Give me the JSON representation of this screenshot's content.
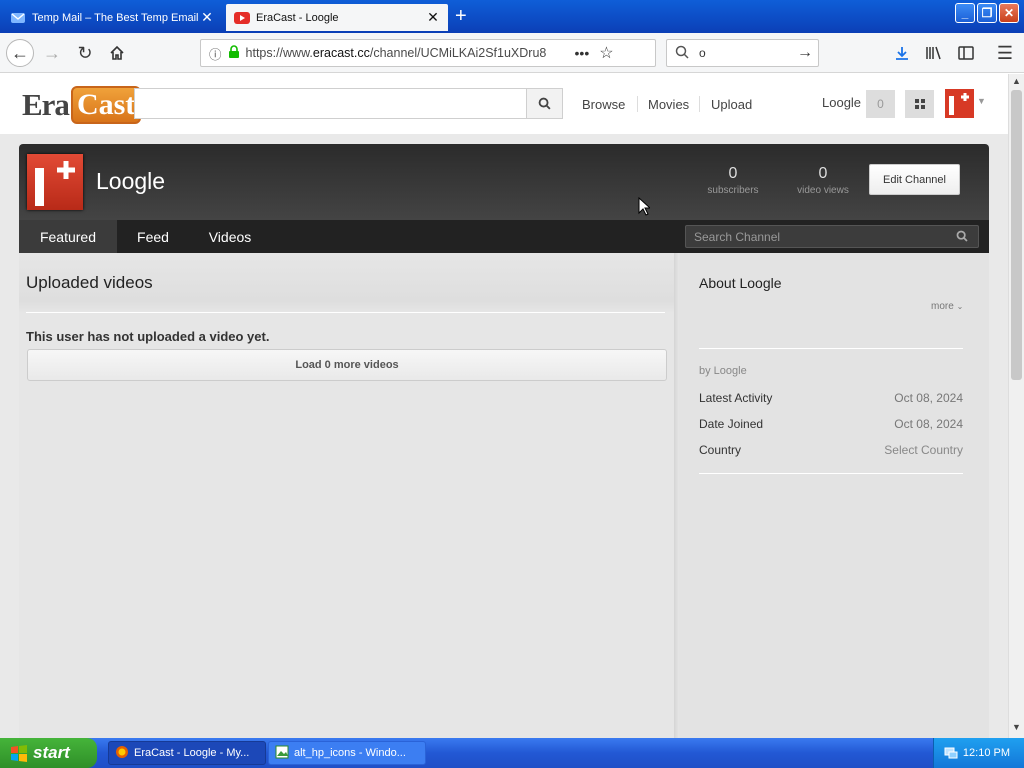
{
  "browser": {
    "tabs": [
      {
        "title": "Temp Mail – The Best Temp Email S",
        "active": false
      },
      {
        "title": "EraCast - Loogle",
        "active": true
      }
    ],
    "url_prefix": "https://www.",
    "url_domain": "eracast.cc",
    "url_path": "/channel/UCMiLKAi2Sf1uXDru8",
    "search_value": "o",
    "colors": {
      "titlebar": "#0b46c0",
      "toolbar": "#f5f6f7",
      "download_icon": "#1a73e8"
    }
  },
  "site": {
    "logo_part1": "Era",
    "logo_part2": "Cast",
    "search_placeholder": "",
    "nav": [
      "Browse",
      "Movies",
      "Upload"
    ],
    "user_name": "Loogle",
    "user_count": "0",
    "accent": "#d73925"
  },
  "channel": {
    "name": "Loogle",
    "subscribers_count": "0",
    "subscribers_label": "subscribers",
    "views_count": "0",
    "views_label": "video views",
    "edit_button": "Edit Channel",
    "tabs": [
      "Featured",
      "Feed",
      "Videos"
    ],
    "search_placeholder": "Search Channel"
  },
  "uploads": {
    "heading": "Uploaded videos",
    "empty_message": "This user has not uploaded a video yet.",
    "load_more": "Load 0 more videos"
  },
  "about": {
    "heading": "About Loogle",
    "more": "more",
    "by": "by Loogle",
    "rows": [
      {
        "label": "Latest Activity",
        "value": "Oct 08, 2024"
      },
      {
        "label": "Date Joined",
        "value": "Oct 08, 2024"
      },
      {
        "label": "Country",
        "value": "Select Country"
      }
    ]
  },
  "taskbar": {
    "start": "start",
    "tasks": [
      "EraCast - Loogle - My...",
      "alt_hp_icons - Windo..."
    ],
    "clock": "12:10 PM"
  }
}
